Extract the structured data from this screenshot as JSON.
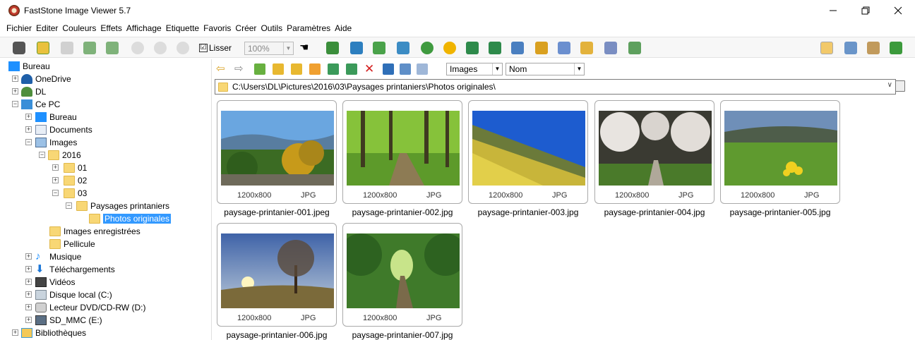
{
  "window": {
    "title": "FastStone Image Viewer 5.7"
  },
  "menu": [
    "Fichier",
    "Editer",
    "Couleurs",
    "Effets",
    "Affichage",
    "Etiquette",
    "Favoris",
    "Créer",
    "Outils",
    "Paramètres",
    "Aide"
  ],
  "toolbar": {
    "smooth_label": "Lisser",
    "smooth_checked": "☑",
    "zoom_value": "100%"
  },
  "tree": {
    "bureau": "Bureau",
    "onedrive": "OneDrive",
    "dl": "DL",
    "cepc": "Ce PC",
    "bureau2": "Bureau",
    "documents": "Documents",
    "images": "Images",
    "y2016": "2016",
    "m01": "01",
    "m02": "02",
    "m03": "03",
    "paysages": "Paysages printaniers",
    "photos": "Photos originales",
    "saved": "Images enregistrées",
    "pellicule": "Pellicule",
    "musique": "Musique",
    "telechargements": "Téléchargements",
    "videos": "Vidéos",
    "disque": "Disque local (C:)",
    "dvd": "Lecteur DVD/CD-RW (D:)",
    "sd": "SD_MMC (E:)",
    "bibliotheques": "Bibliothèques"
  },
  "browser": {
    "filter_value": "Images",
    "sort_value": "Nom",
    "path": "C:\\Users\\DL\\Pictures\\2016\\03\\Paysages printaniers\\Photos originales\\"
  },
  "thumbnails": [
    {
      "name": "paysage-printanier-001.jpeg",
      "dims": "1200x800",
      "format": "JPG"
    },
    {
      "name": "paysage-printanier-002.jpg",
      "dims": "1200x800",
      "format": "JPG"
    },
    {
      "name": "paysage-printanier-003.jpg",
      "dims": "1200x800",
      "format": "JPG"
    },
    {
      "name": "paysage-printanier-004.jpg",
      "dims": "1200x800",
      "format": "JPG"
    },
    {
      "name": "paysage-printanier-005.jpg",
      "dims": "1200x800",
      "format": "JPG"
    },
    {
      "name": "paysage-printanier-006.jpg",
      "dims": "1200x800",
      "format": "JPG"
    },
    {
      "name": "paysage-printanier-007.jpg",
      "dims": "1200x800",
      "format": "JPG"
    }
  ],
  "colors": {
    "selection": "#3399ff",
    "folder": "#f8d775"
  }
}
